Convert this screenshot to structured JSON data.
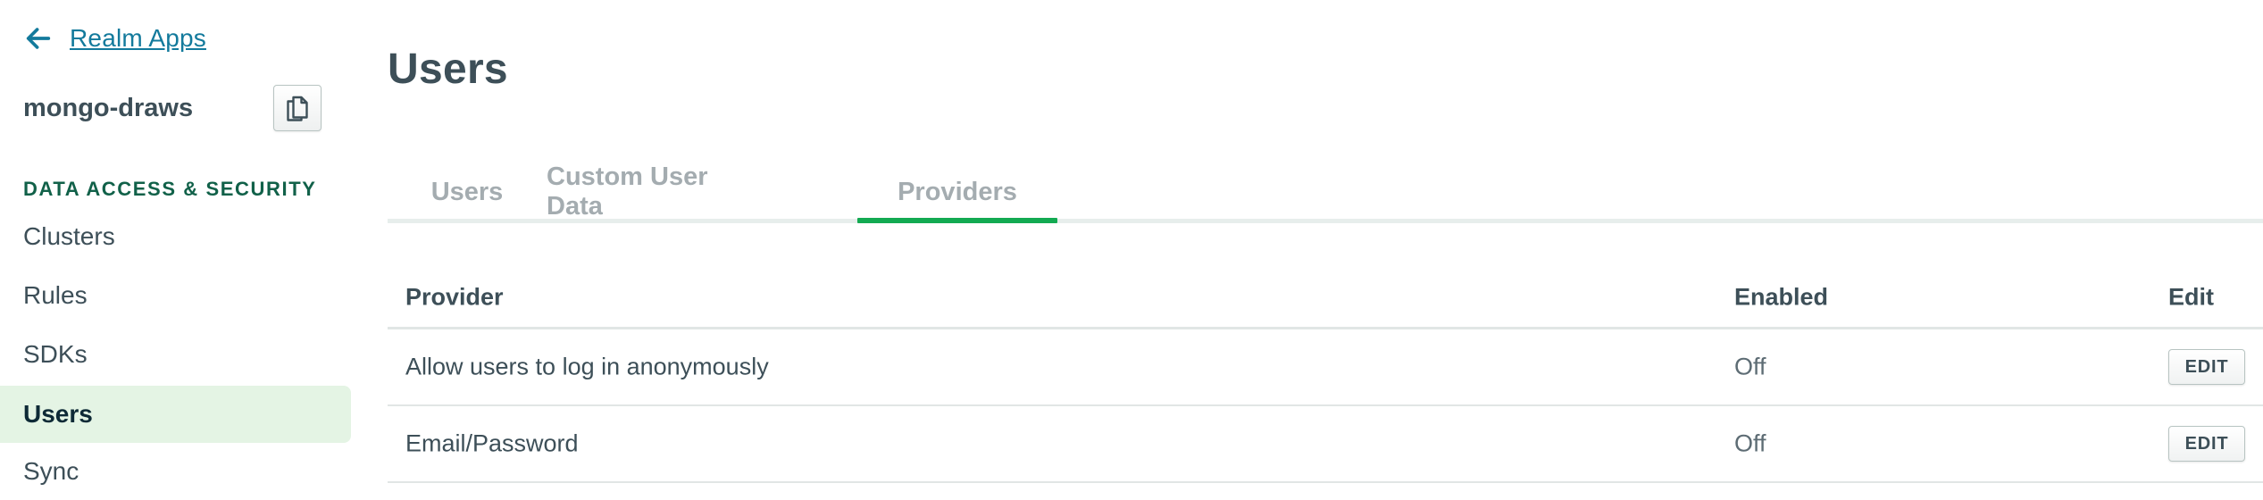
{
  "sidebar": {
    "back_label": "Realm Apps",
    "app_name": "mongo-draws",
    "section_title": "DATA ACCESS & SECURITY",
    "items": [
      {
        "label": "Clusters",
        "active": false
      },
      {
        "label": "Rules",
        "active": false
      },
      {
        "label": "SDKs",
        "active": false
      },
      {
        "label": "Users",
        "active": true
      },
      {
        "label": "Sync",
        "active": false
      }
    ]
  },
  "main": {
    "title": "Users",
    "tabs": [
      {
        "label": "Users",
        "active": false
      },
      {
        "label": "Custom User Data",
        "active": false
      },
      {
        "label": "Providers",
        "active": true
      }
    ],
    "table": {
      "headers": {
        "provider": "Provider",
        "enabled": "Enabled",
        "edit": "Edit"
      },
      "rows": [
        {
          "provider": "Allow users to log in anonymously",
          "enabled": "Off",
          "action": "EDIT"
        },
        {
          "provider": "Email/Password",
          "enabled": "Off",
          "action": "EDIT"
        }
      ]
    }
  },
  "colors": {
    "accent_green": "#13aa52",
    "link_blue": "#137a9c",
    "section_green": "#116149",
    "active_nav_bg": "#e4f4e4"
  },
  "icons": {
    "back": "arrow-left-icon",
    "copy": "copy-icon"
  }
}
